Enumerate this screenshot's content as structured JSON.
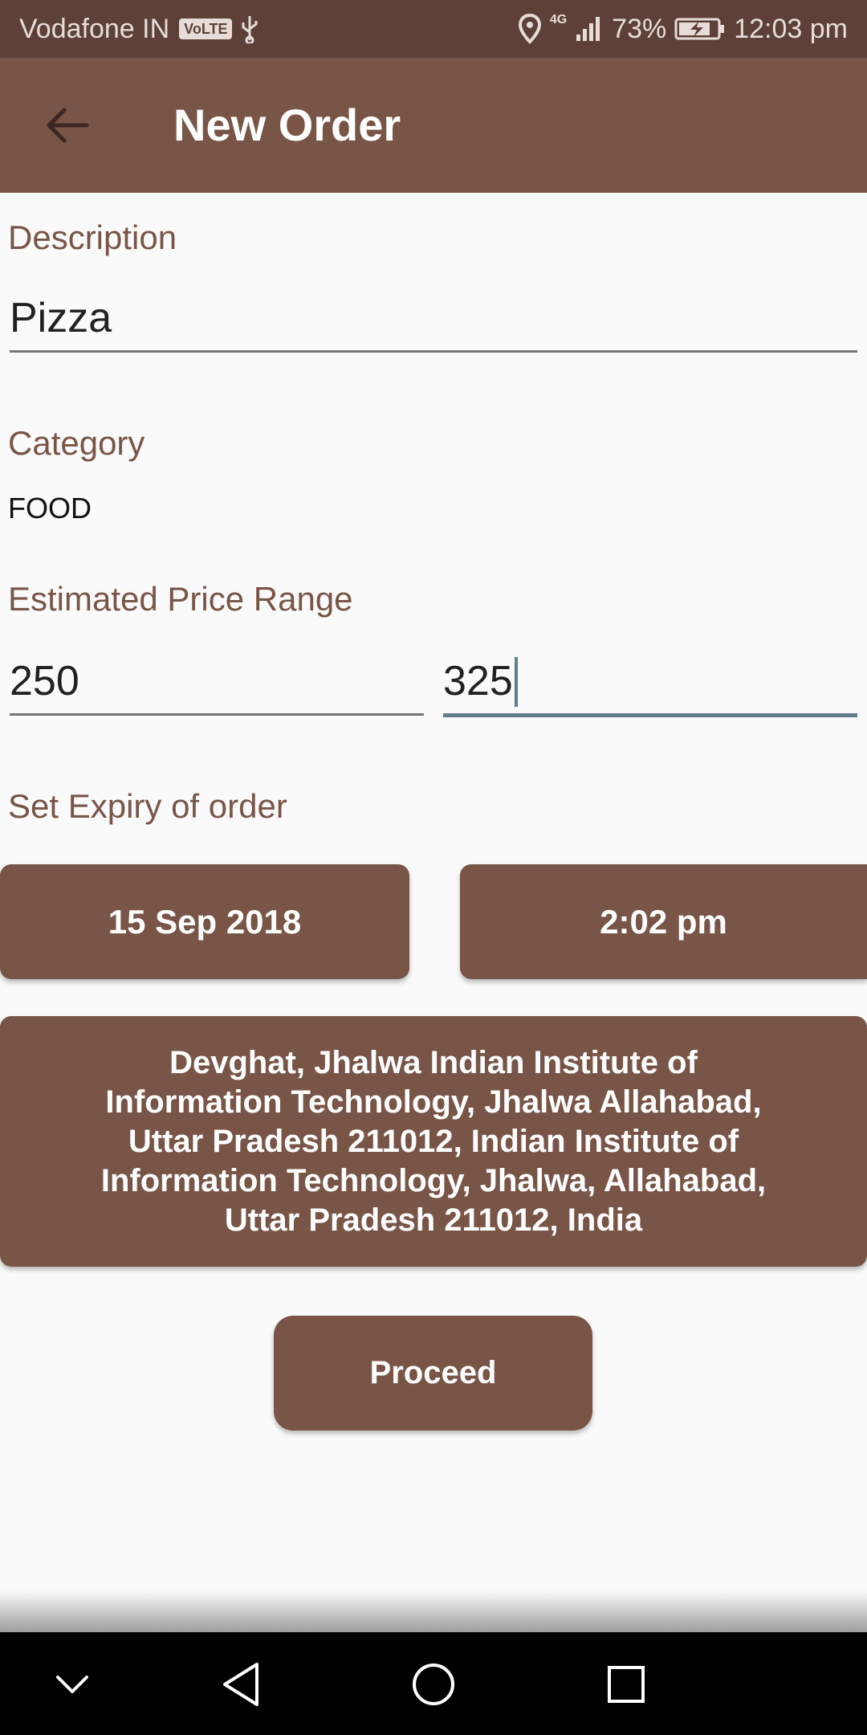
{
  "status_bar": {
    "carrier": "Vodafone IN",
    "volte": "VoLTE",
    "network": "4G",
    "battery": "73%",
    "time": "12:03 pm"
  },
  "app_bar": {
    "title": "New Order"
  },
  "form": {
    "description": {
      "label": "Description",
      "value": "Pizza"
    },
    "category": {
      "label": "Category",
      "value": "FOOD"
    },
    "price_range": {
      "label": "Estimated Price Range",
      "min": "250",
      "max": "325"
    },
    "expiry": {
      "label": "Set Expiry of order",
      "date": "15 Sep 2018",
      "time": "2:02 pm"
    },
    "address": "Devghat, Jhalwa Indian Institute of Information Technology, Jhalwa Allahabad, Uttar Pradesh 211012, Indian Institute of Information Technology, Jhalwa, Allahabad, Uttar Pradesh 211012, India",
    "proceed_label": "Proceed"
  },
  "colors": {
    "primary": "#795548",
    "primary_dark": "#5d4037",
    "accent": "#607d8b",
    "background": "#fafafa"
  },
  "icons": {
    "back": "arrow-back-icon",
    "nav_collapse": "chevron-down-icon",
    "nav_back": "triangle-back-icon",
    "nav_home": "circle-home-icon",
    "nav_recents": "square-recents-icon"
  }
}
